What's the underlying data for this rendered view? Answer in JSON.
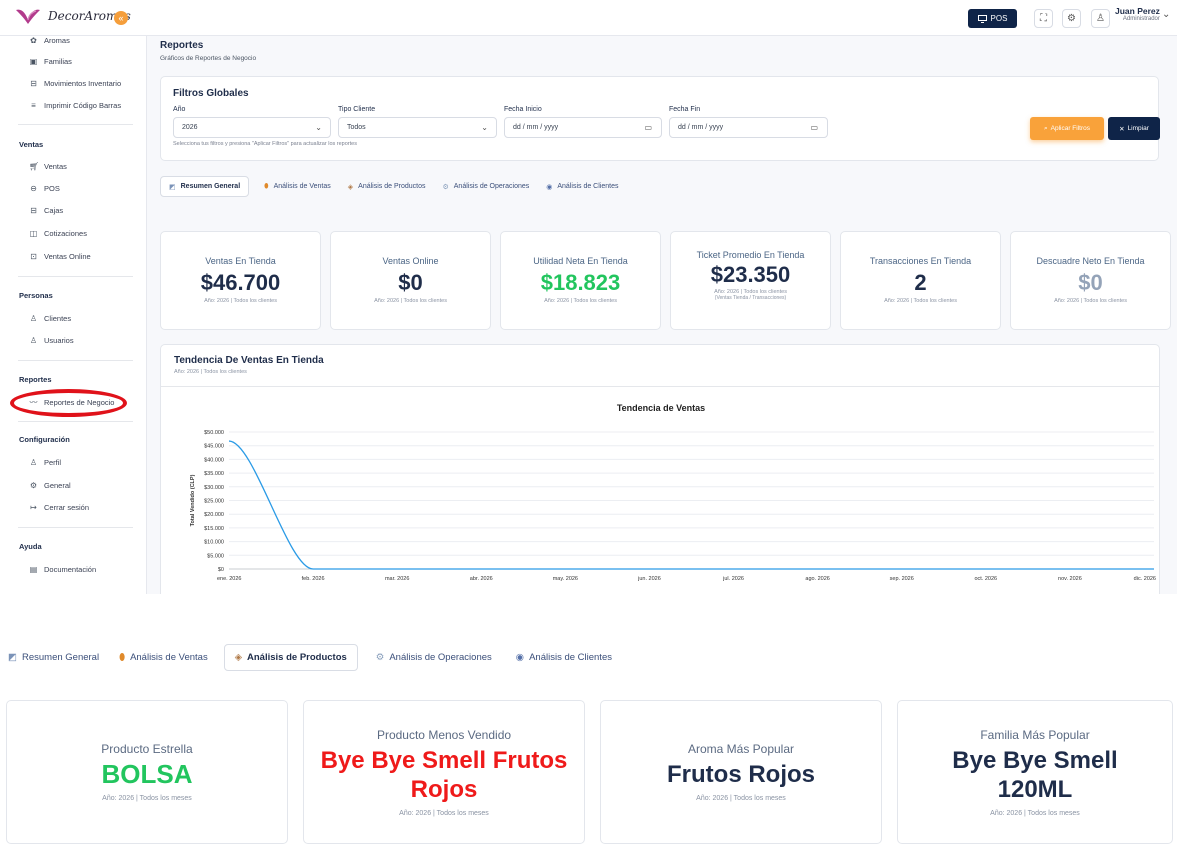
{
  "header": {
    "logo_text": "DecorAromas",
    "pos_label": "POS",
    "user_name": "Juan Perez",
    "user_role": "Administrador"
  },
  "sidebar": {
    "top_items": [
      {
        "label": "Aromas",
        "icon": "aroma-icon"
      },
      {
        "label": "Familias",
        "icon": "folder-icon"
      },
      {
        "label": "Movimientos Inventario",
        "icon": "box-icon"
      },
      {
        "label": "Imprimir Código Barras",
        "icon": "barcode-icon"
      }
    ],
    "sections": [
      {
        "title": "Ventas",
        "items": [
          {
            "label": "Ventas",
            "icon": "cart-icon"
          },
          {
            "label": "POS",
            "icon": "pos-icon"
          },
          {
            "label": "Cajas",
            "icon": "cash-register-icon"
          },
          {
            "label": "Cotizaciones",
            "icon": "document-icon"
          },
          {
            "label": "Ventas Online",
            "icon": "online-icon"
          }
        ]
      },
      {
        "title": "Personas",
        "items": [
          {
            "label": "Clientes",
            "icon": "user-icon"
          },
          {
            "label": "Usuarios",
            "icon": "users-icon"
          }
        ]
      },
      {
        "title": "Reportes",
        "items": [
          {
            "label": "Reportes de Negocio",
            "icon": "trend-icon"
          }
        ]
      },
      {
        "title": "Configuración",
        "items": [
          {
            "label": "Perfil",
            "icon": "user-icon"
          },
          {
            "label": "General",
            "icon": "gear-icon"
          },
          {
            "label": "Cerrar sesión",
            "icon": "logout-icon"
          }
        ]
      },
      {
        "title": "Ayuda",
        "items": [
          {
            "label": "Documentación",
            "icon": "document-icon"
          }
        ]
      }
    ]
  },
  "page": {
    "title": "Reportes",
    "subtitle": "Gráficos de Reportes de Negocio"
  },
  "filters": {
    "title": "Filtros Globales",
    "year_label": "Año",
    "year_value": "2026",
    "client_type_label": "Tipo Cliente",
    "client_type_value": "Todos",
    "start_label": "Fecha Inicio",
    "start_placeholder": "dd / mm / yyyy",
    "end_label": "Fecha Fin",
    "end_placeholder": "dd / mm / yyyy",
    "help": "Selecciona tus filtros y presiona \"Aplicar Filtros\" para actualizar los reportes",
    "apply_label": "Aplicar Filtros",
    "clear_label": "Limpiar"
  },
  "tabs": [
    {
      "label": "Resumen General",
      "icon": "chart-icon"
    },
    {
      "label": "Análisis de Ventas",
      "icon": "money-bag-icon"
    },
    {
      "label": "Análisis de Productos",
      "icon": "box-icon"
    },
    {
      "label": "Análisis de Operaciones",
      "icon": "gear-icon"
    },
    {
      "label": "Análisis de Clientes",
      "icon": "people-icon"
    }
  ],
  "kpis": [
    {
      "title": "Ventas En Tienda",
      "value": "$46.700",
      "sub": "Año: 2026 | Todos los clientes",
      "note": "",
      "color": "#1f2d4a"
    },
    {
      "title": "Ventas Online",
      "value": "$0",
      "sub": "Año: 2026 | Todos los clientes",
      "note": "",
      "color": "#1f2d4a"
    },
    {
      "title": "Utilidad Neta En Tienda",
      "value": "$18.823",
      "sub": "Año: 2026 | Todos los clientes",
      "note": "",
      "color": "#22c55e"
    },
    {
      "title": "Ticket Promedio En Tienda",
      "value": "$23.350",
      "sub": "Año: 2026 | Todos los clientes",
      "note": "(Ventas Tienda / Transacciones)",
      "color": "#1f2d4a"
    },
    {
      "title": "Transacciones En Tienda",
      "value": "2",
      "sub": "Año: 2026 | Todos los clientes",
      "note": "",
      "color": "#1f2d4a"
    },
    {
      "title": "Descuadre Neto En Tienda",
      "value": "$0",
      "sub": "Año: 2026 | Todos los clientes",
      "note": "",
      "color": "#94a3b8"
    }
  ],
  "trend": {
    "title": "Tendencia De Ventas En Tienda",
    "subtitle": "Año: 2026 | Todos los clientes"
  },
  "chart_data": {
    "type": "line",
    "title": "Tendencia de Ventas",
    "ylabel": "Total Vendido (CLP)",
    "xlabel": "",
    "categories": [
      "ene. 2026",
      "feb. 2026",
      "mar. 2026",
      "abr. 2026",
      "may. 2026",
      "jun. 2026",
      "jul. 2026",
      "ago. 2026",
      "sep. 2026",
      "oct. 2026",
      "nov. 2026",
      "dic. 2026"
    ],
    "series": [
      {
        "values": [
          46700,
          0,
          0,
          0,
          0,
          0,
          0,
          0,
          0,
          0,
          0,
          0
        ],
        "color": "#2b9be6"
      }
    ],
    "ylim": [
      0,
      50000
    ],
    "yticks": [
      "$0",
      "$5.000",
      "$10.000",
      "$15.000",
      "$20.000",
      "$25.000",
      "$30.000",
      "$35.000",
      "$40.000",
      "$45.000",
      "$50.000"
    ],
    "grid": true
  },
  "products": {
    "cards": [
      {
        "title": "Producto Estrella",
        "value": "BOLSA",
        "sub": "Año: 2026 | Todos los meses",
        "color": "#22c55e"
      },
      {
        "title": "Producto Menos Vendido",
        "value": "Bye Bye Smell Frutos Rojos",
        "sub": "Año: 2026 | Todos los meses",
        "color": "#ef1a1a"
      },
      {
        "title": "Aroma Más Popular",
        "value": "Frutos Rojos",
        "sub": "Año: 2026 | Todos los meses",
        "color": "#1f2d4a"
      },
      {
        "title": "Familia Más Popular",
        "value": "Bye Bye Smell 120ML",
        "sub": "Año: 2026 | Todos los meses",
        "color": "#1f2d4a"
      }
    ]
  }
}
